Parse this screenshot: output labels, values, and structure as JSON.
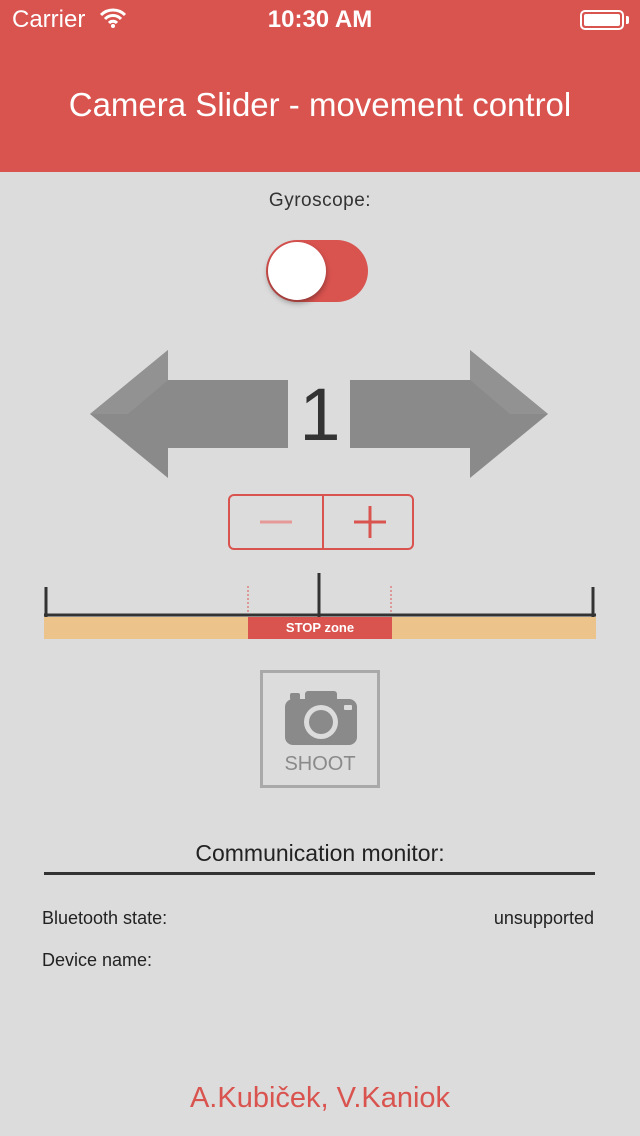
{
  "status_bar": {
    "carrier": "Carrier",
    "time": "10:30 AM",
    "wifi_icon": "wifi-icon",
    "battery_icon": "battery-icon"
  },
  "header": {
    "title": "Camera Slider - movement control",
    "color": "#d9534f"
  },
  "gyroscope": {
    "label": "Gyroscope:",
    "enabled": false
  },
  "movement": {
    "speed": "1",
    "left_icon": "arrow-left-icon",
    "right_icon": "arrow-right-icon"
  },
  "stepper": {
    "minus_label": "−",
    "plus_label": "+"
  },
  "scale": {
    "stop_zone_label": "STOP zone"
  },
  "shoot": {
    "label": "SHOOT",
    "icon": "camera-icon"
  },
  "monitor": {
    "title": "Communication monitor:",
    "rows": [
      {
        "label": "Bluetooth state:",
        "value": "unsupported"
      },
      {
        "label": "Device name:",
        "value": ""
      }
    ]
  },
  "footer": {
    "authors": "A.Kubiček, V.Kaniok"
  }
}
